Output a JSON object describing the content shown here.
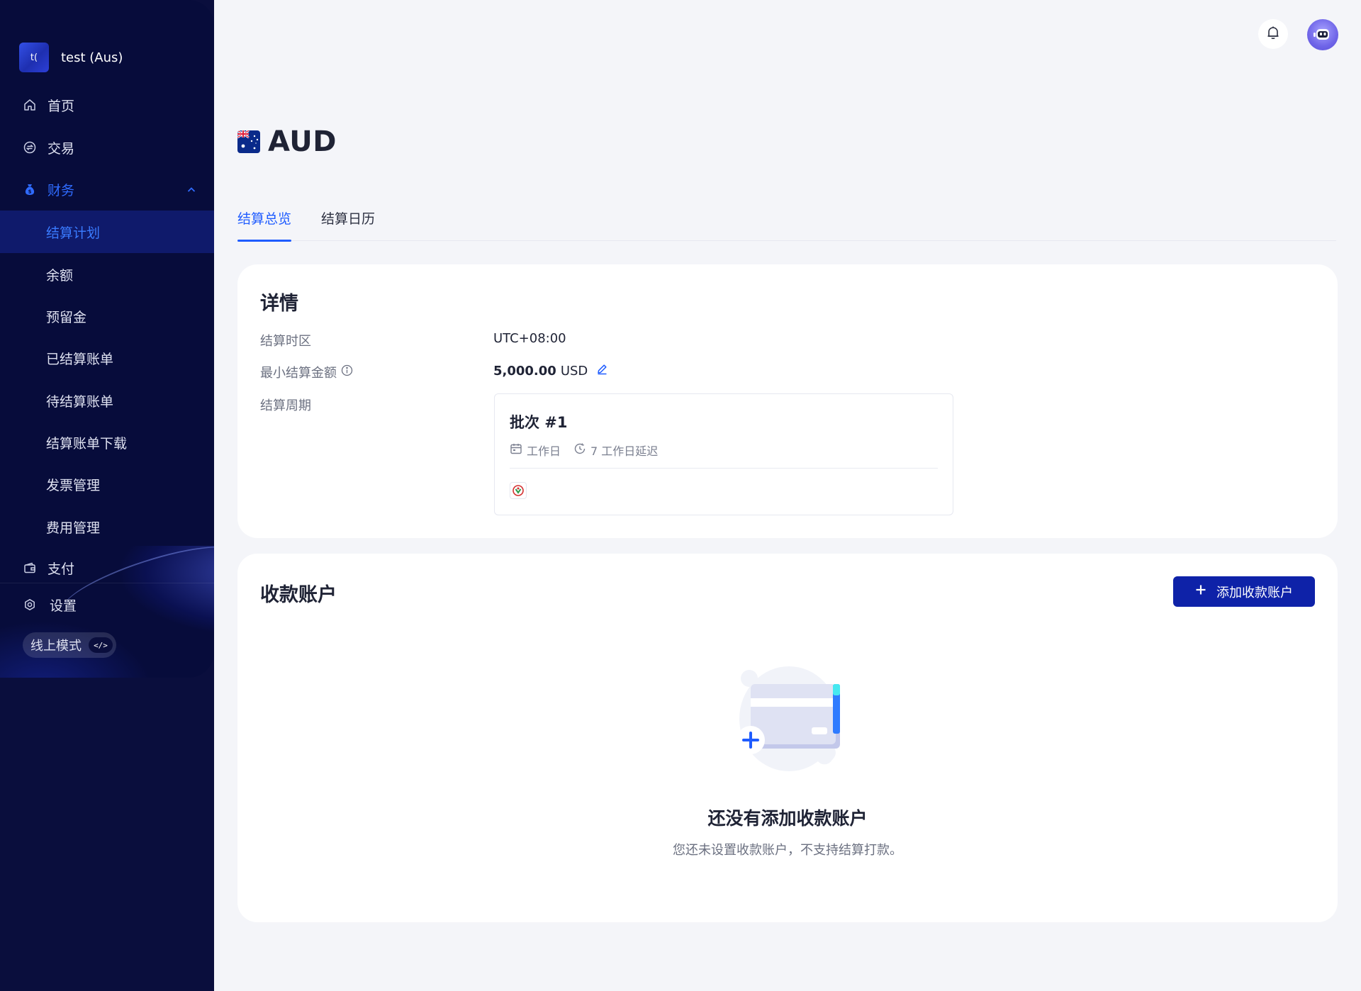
{
  "app": {
    "org_logo_text": "t(",
    "org_name": "test (Aus)"
  },
  "sidebar": {
    "items": [
      {
        "label": "首页",
        "icon": "home-icon"
      },
      {
        "label": "交易",
        "icon": "exchange-icon"
      },
      {
        "label": "财务",
        "icon": "money-bag-icon",
        "expanded": true
      },
      {
        "label": "支付",
        "icon": "wallet-icon"
      },
      {
        "label": "设置",
        "icon": "gear-icon"
      }
    ],
    "finance_sub": [
      {
        "label": "结算计划",
        "selected": true
      },
      {
        "label": "余额"
      },
      {
        "label": "预留金"
      },
      {
        "label": "已结算账单"
      },
      {
        "label": "待结算账单"
      },
      {
        "label": "结算账单下载"
      },
      {
        "label": "发票管理"
      },
      {
        "label": "费用管理"
      }
    ],
    "mode_label": "线上模式",
    "mode_badge": "</>"
  },
  "header": {
    "currency": "AUD",
    "flag": "australia-flag"
  },
  "tabs": [
    {
      "label": "结算总览",
      "active": true
    },
    {
      "label": "结算日历",
      "active": false
    }
  ],
  "details": {
    "title": "详情",
    "timezone_label": "结算时区",
    "timezone_value": "UTC+08:00",
    "min_amount_label": "最小结算金额",
    "min_amount_value": "5,000.00",
    "min_amount_currency": "USD",
    "cycle_label": "结算周期",
    "batch": {
      "title": "批次 #1",
      "day_type": "工作日",
      "delay": "7 工作日延迟"
    }
  },
  "accounts": {
    "title": "收款账户",
    "add_button": "添加收款账户",
    "empty_title": "还没有添加收款账户",
    "empty_desc": "您还未设置收款账户，不支持结算打款。"
  },
  "colors": {
    "sidebar_bg": "#070c3b",
    "accent": "#1f5cff",
    "primary_button": "#0e22a8",
    "page_bg": "#f4f5f9"
  }
}
